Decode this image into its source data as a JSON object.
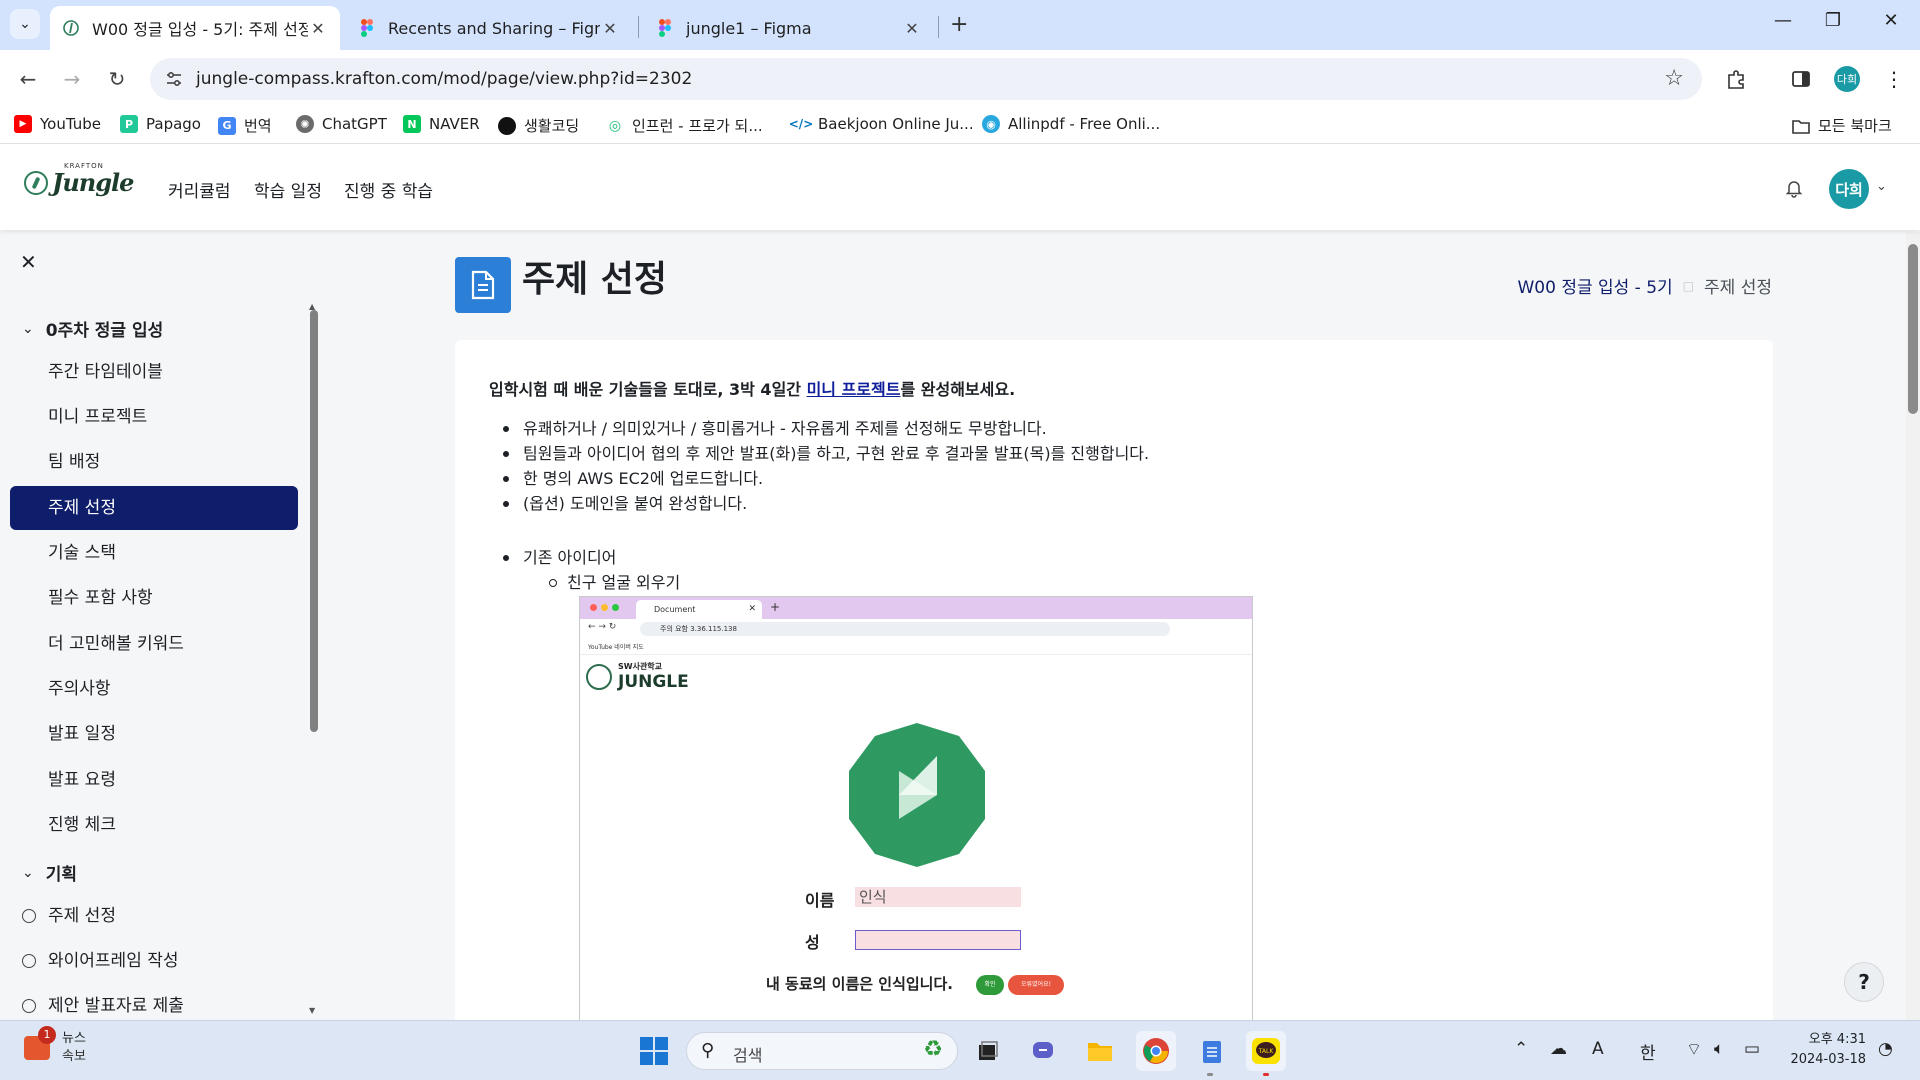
{
  "browser": {
    "tabs": [
      {
        "title": "W00 정글 입성 - 5기: 주제 선정",
        "active": true
      },
      {
        "title": "Recents and Sharing – Figma",
        "active": false
      },
      {
        "title": "jungle1 – Figma",
        "active": false
      }
    ],
    "url": "jungle-compass.krafton.com/mod/page/view.php?id=2302",
    "profile_initials": "다희",
    "bookmarks": [
      {
        "label": "YouTube",
        "icon": "youtube-icon",
        "color": "#ff0000"
      },
      {
        "label": "Papago",
        "icon": "papago-icon",
        "color": "#20c997"
      },
      {
        "label": "번역",
        "icon": "translate-icon",
        "color": "#4285f4"
      },
      {
        "label": "ChatGPT",
        "icon": "chatgpt-icon",
        "color": "#6b6b6b"
      },
      {
        "label": "NAVER",
        "icon": "naver-icon",
        "color": "#03c75a"
      },
      {
        "label": "생활코딩",
        "icon": "opentutorials-icon",
        "color": "#111111"
      },
      {
        "label": "인프런 - 프로가 되...",
        "icon": "inflearn-icon",
        "color": "#1dc078"
      },
      {
        "label": "Baekjoon Online Ju...",
        "icon": "baekjoon-icon",
        "color": "#0076c0"
      },
      {
        "label": "Allinpdf - Free Onli...",
        "icon": "allinpdf-icon",
        "color": "#29a8e0"
      }
    ],
    "all_bookmarks": "모든 북마크"
  },
  "site": {
    "logo_small": "KRAFTON",
    "logo_text": "Jungle",
    "nav": [
      "커리큘럼",
      "학습 일정",
      "진행 중 학습"
    ],
    "avatar": "다희"
  },
  "sidebar": {
    "sections": [
      {
        "title": "0주차 정글 입성",
        "items": [
          {
            "label": "주간 타임테이블",
            "active": false
          },
          {
            "label": "미니 프로젝트",
            "active": false
          },
          {
            "label": "팀 배정",
            "active": false
          },
          {
            "label": "주제 선정",
            "active": true
          },
          {
            "label": "기술 스택",
            "active": false
          },
          {
            "label": "필수 포함 사항",
            "active": false
          },
          {
            "label": "더 고민해볼 키워드",
            "active": false
          },
          {
            "label": "주의사항",
            "active": false
          },
          {
            "label": "발표 일정",
            "active": false
          },
          {
            "label": "발표 요령",
            "active": false
          },
          {
            "label": "진행 체크",
            "active": false
          }
        ]
      },
      {
        "title": "기획",
        "items": [
          {
            "label": "주제 선정"
          },
          {
            "label": "와이어프레임 작성"
          },
          {
            "label": "제안 발표자료 제출"
          }
        ]
      }
    ]
  },
  "page": {
    "title": "주제 선정",
    "breadcrumb": {
      "parent": "W00 정글 입성 - 5기",
      "current": "주제 선정"
    },
    "intro_before": "입학시험 때 배운 기술들을 토대로, 3박 4일간 ",
    "intro_link": "미니 프로젝트",
    "intro_after": "를 완성해보세요.",
    "bullets": [
      "유쾌하거나 / 의미있거나 / 흥미롭거나 - 자유롭게 주제를 선정해도 무방합니다.",
      "팀원들과 아이디어 협의 후 제안 발표(화)를 하고, 구현 완료 후 결과물 발표(목)를 진행합니다.",
      "한 명의 AWS EC2에 업로드합니다.",
      "(옵션) 도메인을 붙여 완성합니다."
    ],
    "existing_ideas": "기존 아이디어",
    "sub_ideas": [
      "친구 얼굴 외우기"
    ],
    "screenshot": {
      "tab_title": "Document",
      "url_text": "주의 요함  3.36.115.138",
      "bookmarks": "YouTube   네이버 지도",
      "logo_top": "SW사관학교",
      "logo_bottom": "JUNGLE",
      "label_first": "이름",
      "value_first": "인식",
      "label_last": "성",
      "value_last": "",
      "result": "내 동료의 이름은 인식입니다.",
      "btn_ok": "확인",
      "btn_wrong": "오류였어요!"
    }
  },
  "taskbar": {
    "news_title": "뉴스",
    "news_sub": "속보",
    "news_badge": "1",
    "search_placeholder": "검색",
    "ime": "한",
    "time": "오후 4:31",
    "date": "2024-03-18"
  }
}
